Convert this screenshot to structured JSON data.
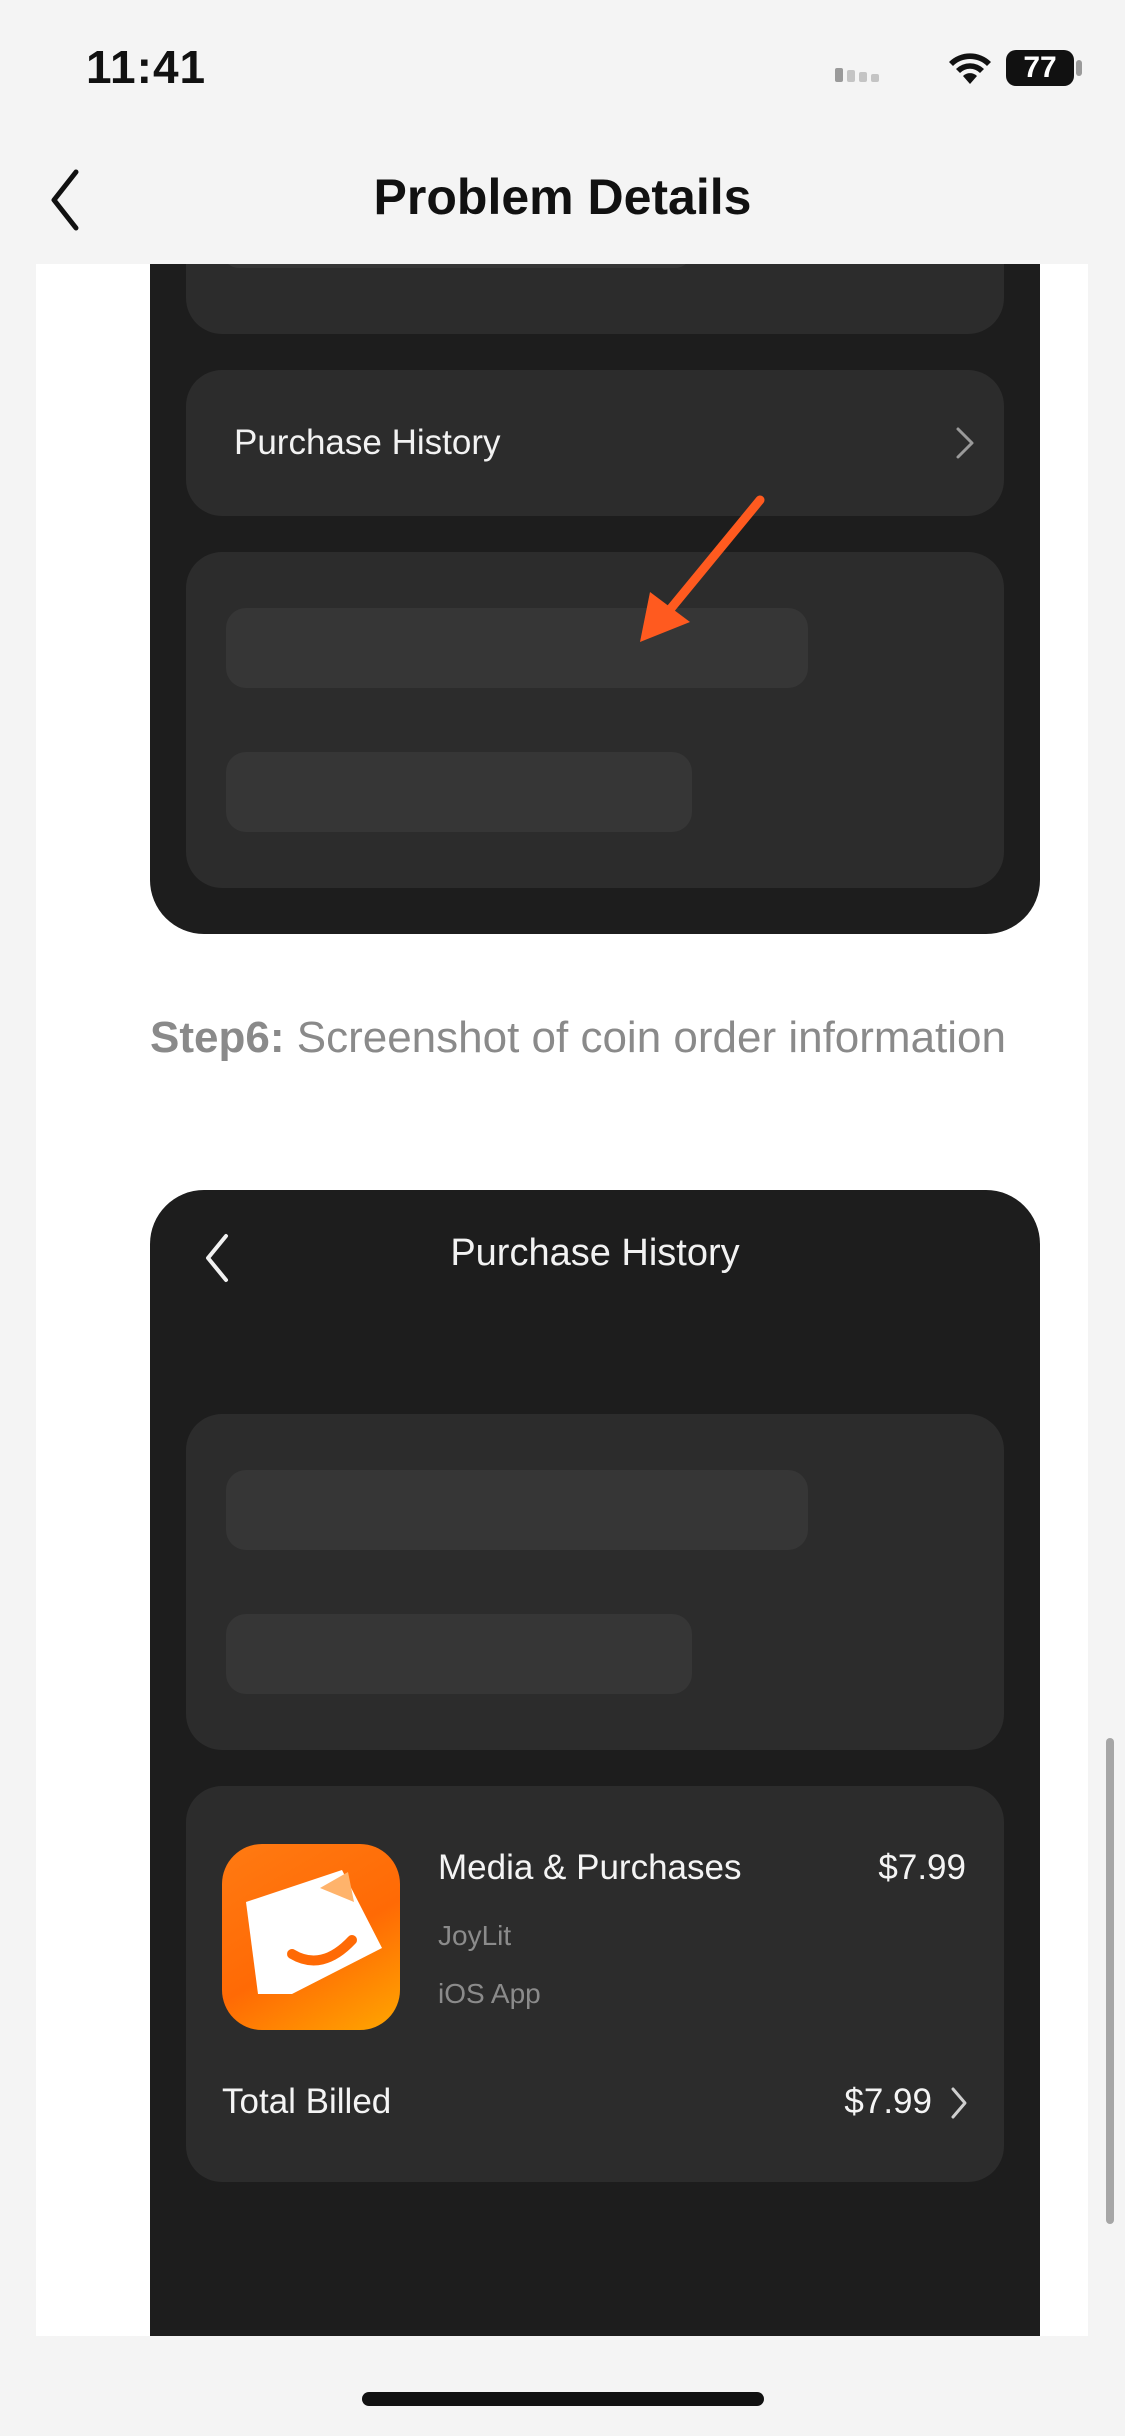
{
  "status_bar": {
    "time": "11:41",
    "battery": "77"
  },
  "nav": {
    "title": "Problem Details"
  },
  "step5_mock": {
    "row_label": "Purchase History"
  },
  "step6": {
    "label": "Step6:",
    "text": "Screenshot of coin order information"
  },
  "step6_mock": {
    "title": "Purchase History",
    "item": {
      "title": "Media & Purchases",
      "price": "$7.99",
      "app_name": "JoyLit",
      "platform": "iOS App"
    },
    "total": {
      "label": "Total Billed",
      "value": "$7.99"
    }
  },
  "colors": {
    "arrow": "#ff5a1f",
    "app_icon_orange": "#ff6a05",
    "mock_background": "#1d1d1d"
  }
}
